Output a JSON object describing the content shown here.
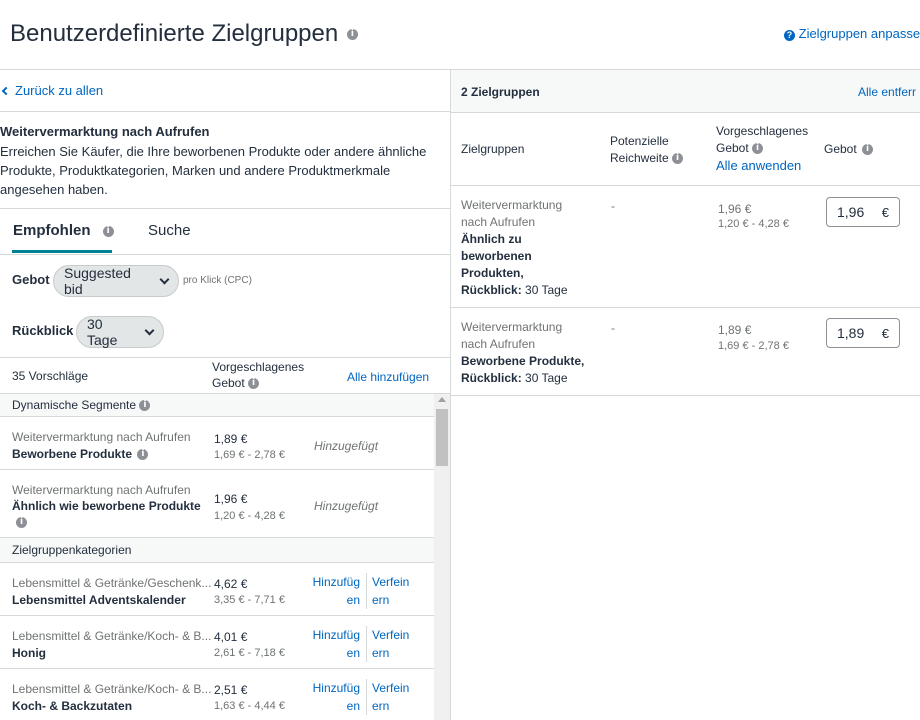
{
  "header": {
    "title": "Benutzerdefinierte Zielgruppen",
    "help_link": "Zielgruppen anpasse"
  },
  "left": {
    "back_link": "Zurück zu allen",
    "section_title": "Weitervermarktung nach Aufrufen",
    "section_desc": "Erreichen Sie Käufer, die Ihre beworbenen Produkte oder andere ähnliche Produkte, Produktkategorien, Marken und andere Produktmerkmale angesehen haben.",
    "tabs": [
      {
        "label": "Empfohlen",
        "active": true
      },
      {
        "label": "Suche",
        "active": false
      }
    ],
    "bid": {
      "label": "Gebot",
      "value": "Suggested bid",
      "suffix": "pro Klick (CPC)"
    },
    "lookback": {
      "label": "Rückblick",
      "value": "30 Tage"
    },
    "table": {
      "count": "35 Vorschläge",
      "bid_header": "Vorgeschlagenes Gebot",
      "add_all": "Alle hinzufügen"
    },
    "groups": [
      {
        "name": "Dynamische Segmente",
        "rows": [
          {
            "category": "Weitervermarktung nach Aufrufen",
            "name": "Beworbene Produkte",
            "bid": "1,89 €",
            "range": "1,69 € - 2,78 €",
            "status": "Hinzugefügt"
          },
          {
            "category": "Weitervermarktung nach Aufrufen",
            "name": "Ähnlich wie beworbene Produkte",
            "bid": "1,96 €",
            "range": "1,20 € - 4,28 €",
            "status": "Hinzugefügt"
          }
        ]
      },
      {
        "name": "Zielgruppenkategorien",
        "rows": [
          {
            "category": "Lebensmittel & Getränke/Geschenk...",
            "name": "Lebensmittel Adventskalender",
            "bid": "4,62 €",
            "range": "3,35 € - 7,71 €",
            "add": "Hinzufüg en",
            "refine": "Verfein ern"
          },
          {
            "category": "Lebensmittel & Getränke/Koch- & B...",
            "name": "Honig",
            "bid": "4,01 €",
            "range": "2,61 € - 7,18 €",
            "add": "Hinzufüg en",
            "refine": "Verfein ern"
          },
          {
            "category": "Lebensmittel & Getränke/Koch- & B...",
            "name": "Koch- & Backzutaten",
            "bid": "2,51 €",
            "range": "1,63 € - 4,44 €",
            "add": "Hinzufüg en",
            "refine": "Verfein ern"
          }
        ]
      }
    ]
  },
  "right": {
    "count": "2 Zielgruppen",
    "remove_all": "Alle entferr",
    "headers": {
      "audience": "Zielgruppen",
      "reach": "Potenzielle Reichweite",
      "suggested": "Vorgeschlagenes Gebot",
      "apply_all": "Alle anwenden",
      "bid": "Gebot"
    },
    "rows": [
      {
        "line1": "Weitervermarktung",
        "line2": "nach Aufrufen",
        "bold": "Ähnlich zu beworbenen Produkten,",
        "lookback_label": "Rückblick:",
        "lookback_value": "30 Tage",
        "reach": "-",
        "bid": "1,96 €",
        "range": "1,20 € - 4,28 €",
        "input": "1,96",
        "currency": "€"
      },
      {
        "line1": "Weitervermarktung",
        "line2": "nach Aufrufen",
        "bold": "Beworbene Produkte,",
        "lookback_label": "Rückblick:",
        "lookback_value": "30 Tage",
        "reach": "-",
        "bid": "1,89 €",
        "range": "1,69 € - 2,78 €",
        "input": "1,89",
        "currency": "€"
      }
    ]
  }
}
